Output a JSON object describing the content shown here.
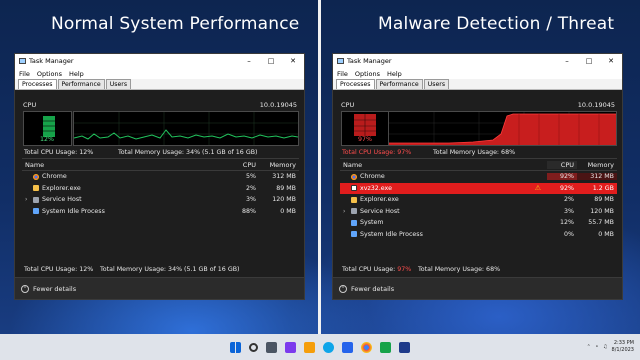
{
  "headings": {
    "left": "Normal System Performance",
    "right": "Malware Detection / Threat"
  },
  "window": {
    "title": "Task Manager",
    "menu": [
      "File",
      "Options",
      "Help"
    ],
    "tabs": [
      "Processes",
      "Performance",
      "Users"
    ],
    "cpu_label": "CPU",
    "version": "10.0.19045",
    "footer": "Fewer details"
  },
  "left": {
    "cpu_pct": "12%",
    "summary_cpu": "Total CPU Usage: 12%",
    "summary_mem": "Total Memory Usage: 34% (5.1 GB of 16 GB)",
    "columns": [
      "Name",
      "CPU",
      "Memory"
    ],
    "rows": [
      {
        "name": "Chrome",
        "cpu": "5%",
        "mem": "312 MB",
        "icon": "chrome-icon"
      },
      {
        "name": "Explorer.exe",
        "cpu": "2%",
        "mem": "89 MB",
        "icon": "folder-icon"
      },
      {
        "name": "Service Host",
        "cpu": "3%",
        "mem": "120 MB",
        "icon": "service-icon"
      },
      {
        "name": "System Idle Process",
        "cpu": "88%",
        "mem": "0 MB",
        "icon": "system-icon"
      }
    ],
    "bottom_cpu": "Total CPU Usage: 12%",
    "bottom_mem": "Total Memory Usage: 34% (5.1 GB of 16 GB)"
  },
  "right": {
    "cpu_pct": "97%",
    "summary_cpu": "Total CPU Usage: 97%",
    "summary_mem": "Total Memory Usage: 68%",
    "columns": [
      "Name",
      "CPU",
      "Memory"
    ],
    "rows": [
      {
        "name": "Chrome",
        "cpu": "92%",
        "mem": "312 MB",
        "icon": "chrome-icon"
      },
      {
        "name": "xvz32.exe",
        "cpu": "92%",
        "mem": "1.2 GB",
        "icon": "malware-icon"
      },
      {
        "name": "Explorer.exe",
        "cpu": "2%",
        "mem": "89 MB",
        "icon": "folder-icon"
      },
      {
        "name": "Service Host",
        "cpu": "3%",
        "mem": "120 MB",
        "icon": "service-icon"
      },
      {
        "name": "System",
        "cpu": "12%",
        "mem": "55.7 MB",
        "icon": "system-icon"
      },
      {
        "name": "System Idle Process",
        "cpu": "0%",
        "mem": "0 MB",
        "icon": "system-icon"
      }
    ],
    "bottom_cpu_prefix": "Total CPU Usage: ",
    "bottom_cpu_value": "97%",
    "bottom_mem": "Total Memory Usage: 68%"
  },
  "taskbar": {
    "time": "2:33 PM",
    "date": "8/1/2023"
  },
  "colors": {
    "normal": "#22c55e",
    "threat": "#e11d1d",
    "warning": "#f5c518"
  }
}
